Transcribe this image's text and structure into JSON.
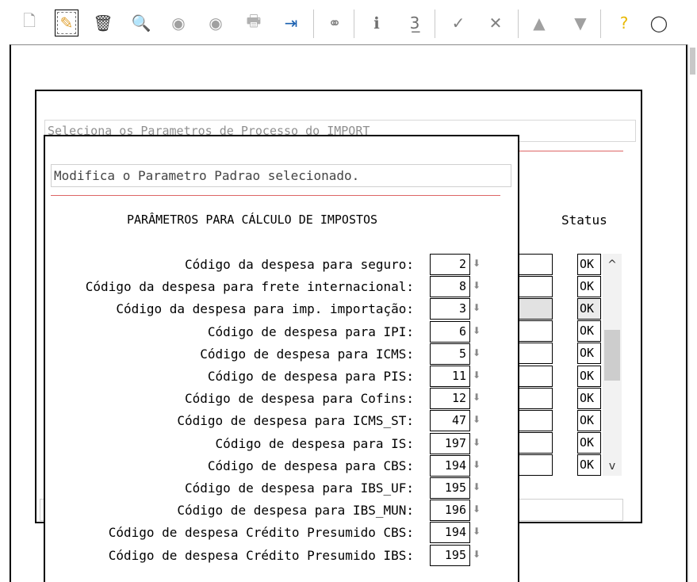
{
  "toolbar": {
    "buttons": [
      {
        "name": "new-document",
        "glyph": "🗋",
        "color": "#9a9a9a"
      },
      {
        "name": "edit",
        "glyph": "✎",
        "color": "#e0a030"
      },
      {
        "name": "delete",
        "glyph": "🗑",
        "color": "#333333"
      },
      {
        "name": "search",
        "glyph": "🔍",
        "color": "#666666"
      },
      {
        "name": "previous-record",
        "glyph": "◉",
        "color": "#a0a0a0"
      },
      {
        "name": "next-record",
        "glyph": "◉",
        "color": "#a0a0a0"
      },
      {
        "name": "print",
        "glyph": "🖶",
        "color": "#b0b0b0"
      },
      {
        "name": "exit",
        "glyph": "⇥",
        "color": "#1a60b0"
      },
      {
        "name": "binoculars",
        "glyph": "⚭",
        "color": "#808080"
      },
      {
        "name": "info",
        "glyph": "ℹ",
        "color": "#707070"
      },
      {
        "name": "number-field",
        "glyph": "3̲",
        "color": "#707070"
      },
      {
        "name": "confirm",
        "glyph": "✓",
        "color": "#808080"
      },
      {
        "name": "cancel",
        "glyph": "✕",
        "color": "#808080"
      },
      {
        "name": "up",
        "glyph": "▲",
        "color": "#a0a0a0"
      },
      {
        "name": "down",
        "glyph": "▼",
        "color": "#a0a0a0"
      },
      {
        "name": "help",
        "glyph": "?",
        "color": "#e8b800"
      },
      {
        "name": "comment",
        "glyph": "◯",
        "color": "#333333"
      }
    ]
  },
  "background_dialog": {
    "description": "Seleciona os Parametros de Processo do IMPORT",
    "status_header": "Status",
    "status_values": [
      "OK",
      "OK",
      "OK",
      "OK",
      "OK",
      "OK",
      "OK",
      "OK",
      "OK",
      "OK"
    ],
    "selected_row": 2
  },
  "front_dialog": {
    "description": "Modifica o Parametro Padrao selecionado.",
    "title": "PARÂMETROS PARA CÁLCULO DE IMPOSTOS",
    "fields": [
      {
        "label": "Código da despesa para seguro:",
        "value": "2"
      },
      {
        "label": "Código da despesa para frete internacional:",
        "value": "8"
      },
      {
        "label": "Código da despesa para imp. importação:",
        "value": "3"
      },
      {
        "label": "Código de despesa para IPI:",
        "value": "6"
      },
      {
        "label": "Código de despesa para ICMS:",
        "value": "5"
      },
      {
        "label": "Código de despesa para PIS:",
        "value": "11"
      },
      {
        "label": "Código de despesa para Cofins:",
        "value": "12"
      },
      {
        "label": "Código de despesa para ICMS_ST:",
        "value": "47"
      },
      {
        "label": "Código de despesa para IS:",
        "value": "197"
      },
      {
        "label": "Código de despesa para CBS:",
        "value": "194"
      },
      {
        "label": "Código de despesa para IBS_UF:",
        "value": "195"
      },
      {
        "label": "Código de despesa para IBS_MUN:",
        "value": "196"
      },
      {
        "label": "Código de despesa Crédito Presumido CBS:",
        "value": "194"
      },
      {
        "label": "Código de despesa Crédito Presumido IBS:",
        "value": "195"
      }
    ]
  },
  "icons": {
    "spin": "⬇",
    "scroll_up": "^",
    "scroll_down": "v"
  }
}
